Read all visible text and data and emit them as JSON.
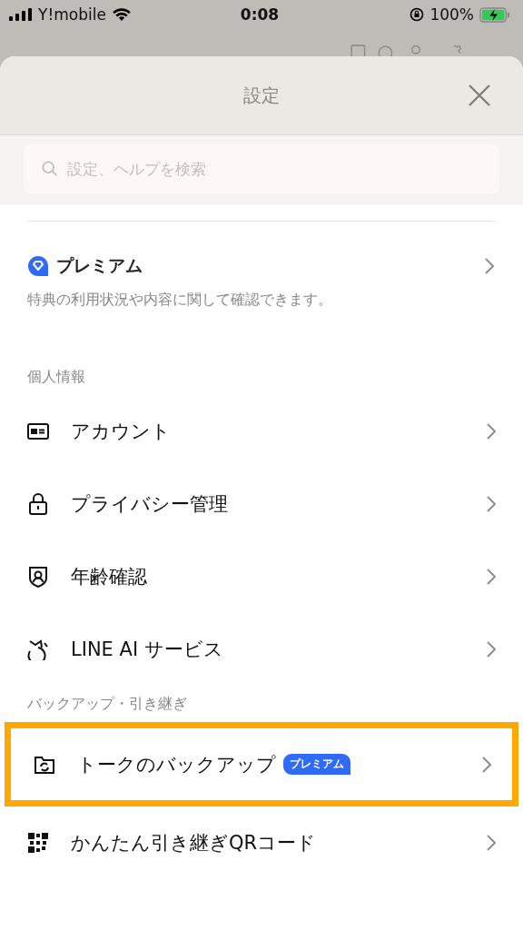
{
  "status_bar": {
    "carrier": "Y!mobile",
    "time": "0:08",
    "battery": "100%"
  },
  "sheet": {
    "title": "設定",
    "search": {
      "placeholder": "設定、ヘルプを検索"
    }
  },
  "premium": {
    "title": "プレミアム",
    "description": "特典の利用状況や内容に関して確認できます。"
  },
  "sections": [
    {
      "header": "個人情報",
      "items": [
        {
          "label": "アカウント",
          "highlighted": false
        },
        {
          "label": "プライバシー管理",
          "highlighted": false
        },
        {
          "label": "年齢確認",
          "highlighted": false
        },
        {
          "label": "LINE AI サービス",
          "highlighted": false
        }
      ]
    },
    {
      "header": "バックアップ・引き継ぎ",
      "items": [
        {
          "label": "トークのバックアップ",
          "badge": "プレミアム",
          "highlighted": true
        },
        {
          "label": "かんたん引き継ぎQRコード",
          "highlighted": false
        }
      ]
    }
  ]
}
